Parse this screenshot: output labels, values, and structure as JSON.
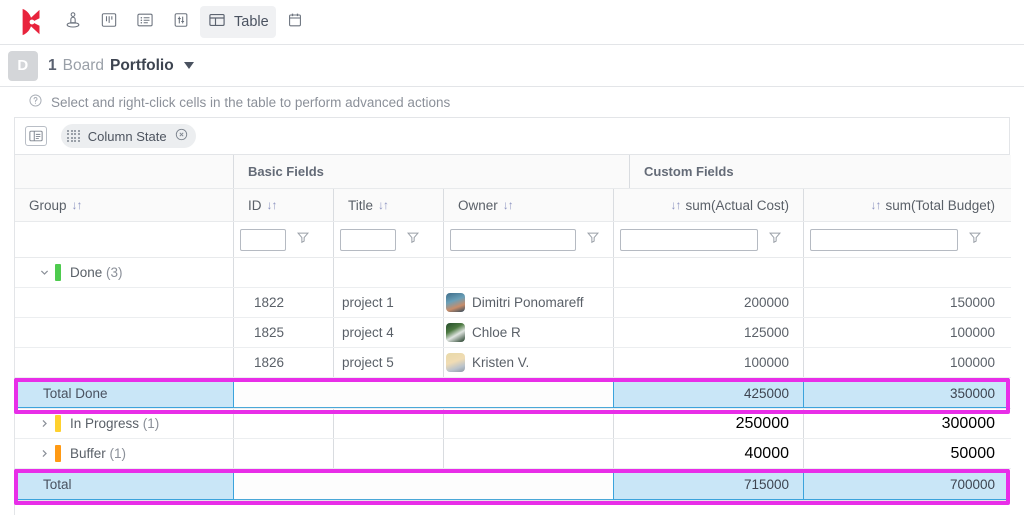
{
  "toolbar": {
    "logo_name": "kanbanize-logo",
    "items": [
      {
        "icon": "workflow-person-icon",
        "label": "",
        "active": false
      },
      {
        "icon": "kanban-board-icon",
        "label": "",
        "active": false
      },
      {
        "icon": "list-view-icon",
        "label": "",
        "active": false
      },
      {
        "icon": "analytics-icon",
        "label": "",
        "active": false
      },
      {
        "icon": "table-view-icon",
        "label": "Table",
        "active": true
      },
      {
        "icon": "calendar-icon",
        "label": "",
        "active": false
      }
    ]
  },
  "titlebar": {
    "badge": "D",
    "board_count": "1",
    "board_word": "Board",
    "board_name": "Portfolio",
    "dropdown_icon": "chevron-down-icon"
  },
  "hint": {
    "icon": "help-circle-icon",
    "text": "Select and right-click cells in the table to perform advanced actions"
  },
  "grouping": {
    "panel_icon": "column-chooser-icon",
    "chip": {
      "handle_icon": "drag-dots-icon",
      "label": "Column State",
      "remove_icon": "remove-circle-icon"
    }
  },
  "table": {
    "field_groups": [
      {
        "label": "Basic Fields"
      },
      {
        "label": "Custom Fields"
      }
    ],
    "columns": [
      {
        "key": "group",
        "label": "Group",
        "sort": "↓↑",
        "align": "left"
      },
      {
        "key": "id",
        "label": "ID",
        "sort": "↓↑",
        "align": "left"
      },
      {
        "key": "title",
        "label": "Title",
        "sort": "↓↑",
        "align": "left"
      },
      {
        "key": "owner",
        "label": "Owner",
        "sort": "↓↑",
        "align": "left"
      },
      {
        "key": "actual",
        "label": "sum(Actual Cost)",
        "sort": "↓↑",
        "align": "right"
      },
      {
        "key": "budget",
        "label": "sum(Total Budget)",
        "sort": "↓↑",
        "align": "right"
      }
    ],
    "filters": {
      "id": "",
      "title": "",
      "owner": "",
      "actual": "",
      "budget": "",
      "placeholder": "",
      "funnel_icon": "filter-funnel-icon"
    },
    "groups": [
      {
        "name": "Done",
        "count": "(3)",
        "color": "#4ecb4e",
        "expanded": true,
        "chevron_icon": "chevron-down-icon",
        "rows": [
          {
            "id": "1822",
            "title": "project 1",
            "owner": "Dimitri Ponomareff",
            "avatar": "avatar-dimitri",
            "actual": "200000",
            "budget": "150000"
          },
          {
            "id": "1825",
            "title": "project 4",
            "owner": "Chloe R",
            "avatar": "avatar-chloe",
            "actual": "125000",
            "budget": "100000"
          },
          {
            "id": "1826",
            "title": "project 5",
            "owner": "Kristen V.",
            "avatar": "avatar-kristen",
            "actual": "100000",
            "budget": "100000"
          }
        ],
        "total": {
          "label": "Total Done",
          "actual": "425000",
          "budget": "350000",
          "selected": true
        }
      },
      {
        "name": "In Progress",
        "count": "(1)",
        "color": "#ffd12e",
        "expanded": false,
        "chevron_icon": "chevron-right-icon",
        "rows": [],
        "total": {
          "label": "",
          "actual": "250000",
          "budget": "300000",
          "selected": false
        }
      },
      {
        "name": "Buffer",
        "count": "(1)",
        "color": "#ff9a14",
        "expanded": false,
        "chevron_icon": "chevron-right-icon",
        "rows": [],
        "total": {
          "label": "",
          "actual": "40000",
          "budget": "50000",
          "selected": false
        }
      }
    ],
    "grand_total": {
      "label": "Total",
      "actual": "715000",
      "budget": "700000",
      "selected": true
    }
  },
  "annotations": {
    "color": "#e82ee8",
    "boxes": [
      {
        "target": "total-done-row"
      },
      {
        "target": "grand-total-row"
      }
    ]
  }
}
